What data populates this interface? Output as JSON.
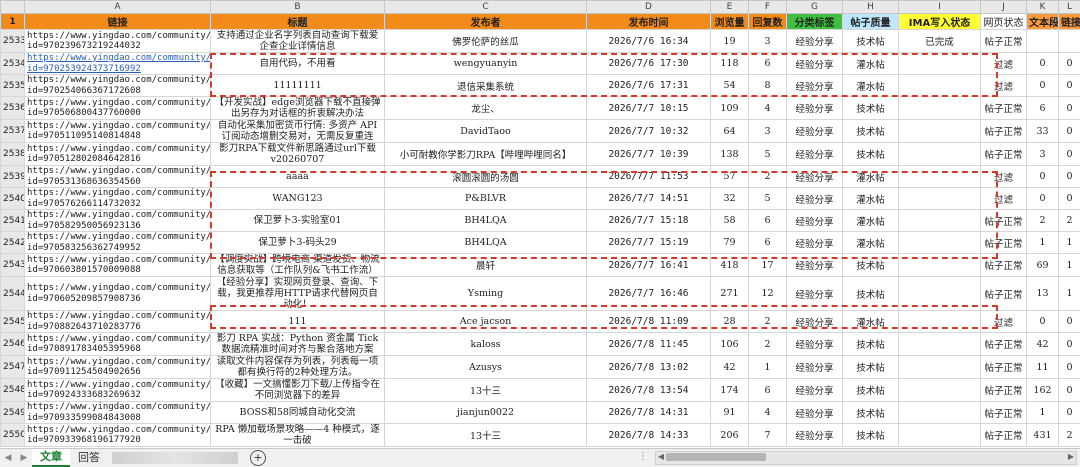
{
  "columns": [
    "A",
    "B",
    "C",
    "D",
    "E",
    "F",
    "G",
    "H",
    "I",
    "J",
    "K",
    "L"
  ],
  "header_row_num": "1",
  "headers": {
    "link": "链接",
    "title": "标题",
    "author": "发布者",
    "time": "发布时间",
    "views": "浏览量",
    "replies": "回复数",
    "label": "分类标签",
    "quality": "帖子质量",
    "ima": "IMA写入状态",
    "status": "网页状态",
    "paragraphs": "文本段落",
    "links": "链接"
  },
  "rows": [
    {
      "num": "2533",
      "url": "https://www.yingdao.com/community/detaildiscuss?id=970239673219244032",
      "title": "支持通过企业名字列表自动查询下载爱企查企业详情信息",
      "author": "佛罗伦萨的丝瓜",
      "time": "2026/7/6 16:34",
      "views": "19",
      "replies": "3",
      "label": "经验分享",
      "quality": "技术帖",
      "ima": "已完成",
      "status": "帖子正常",
      "para": "",
      "links": ""
    },
    {
      "num": "2534",
      "url": "https://www.yingdao.com/community/detaildiscuss?id=970253924373716992",
      "title": "自用代码，不用看",
      "author": "wengyuanyin",
      "time": "2026/7/6 17:30",
      "views": "118",
      "replies": "6",
      "label": "经验分享",
      "quality": "灌水帖",
      "ima": "",
      "status": "过滤",
      "para": "0",
      "links": "0"
    },
    {
      "num": "2535",
      "url": "https://www.yingdao.com/community/detaildiscuss?id=970254066367172608",
      "title": "11111111",
      "author": "退信采集系统",
      "time": "2026/7/6 17:31",
      "views": "54",
      "replies": "8",
      "label": "经验分享",
      "quality": "灌水帖",
      "ima": "",
      "status": "过滤",
      "para": "0",
      "links": "0"
    },
    {
      "num": "2536",
      "url": "https://www.yingdao.com/community/detaildiscuss?id=970506800437760000",
      "title": "【开发实战】edge浏览器下载不直接弹出另存为对话框的折衷解决办法",
      "author": "龙尘、",
      "time": "2026/7/7 10:15",
      "views": "109",
      "replies": "4",
      "label": "经验分享",
      "quality": "技术帖",
      "ima": "",
      "status": "帖子正常",
      "para": "6",
      "links": "0"
    },
    {
      "num": "2537",
      "url": "https://www.yingdao.com/community/detaildiscuss?id=970511095140814848",
      "title": "自动化采集加密货币行情: 多资产 API 订阅动态增删交易对，无需反复重连",
      "author": "DavidTaoo",
      "time": "2026/7/7 10:32",
      "views": "64",
      "replies": "3",
      "label": "经验分享",
      "quality": "技术帖",
      "ima": "",
      "status": "帖子正常",
      "para": "33",
      "links": "0"
    },
    {
      "num": "2538",
      "url": "https://www.yingdao.com/community/detaildiscuss?id=970512802084642816",
      "title": "影刀RPA下载文件新思路通过url下载v20260707",
      "author": "小可耐教你学影刀RPA【哔哩哔哩同名】",
      "time": "2026/7/7 10:39",
      "views": "138",
      "replies": "5",
      "label": "经验分享",
      "quality": "技术帖",
      "ima": "",
      "status": "帖子正常",
      "para": "3",
      "links": "0"
    },
    {
      "num": "2539",
      "url": "https://www.yingdao.com/community/detaildiscuss?id=970531368636354560",
      "title": "aaaa",
      "author": "滚圆滚圆的汤圆",
      "time": "2026/7/7 11:53",
      "views": "57",
      "replies": "2",
      "label": "经验分享",
      "quality": "灌水帖",
      "ima": "",
      "status": "过滤",
      "para": "0",
      "links": "0"
    },
    {
      "num": "2540",
      "url": "https://www.yingdao.com/community/detaildiscuss?id=970576266114732032",
      "title": "WANG123",
      "author": "P&BLVR",
      "time": "2026/7/7 14:51",
      "views": "32",
      "replies": "5",
      "label": "经验分享",
      "quality": "灌水帖",
      "ima": "",
      "status": "过滤",
      "para": "0",
      "links": "0"
    },
    {
      "num": "2541",
      "url": "https://www.yingdao.com/community/detaildiscuss?id=970582950056923136",
      "title": "保卫萝卜3-实验室01",
      "author": "BH4LQA",
      "time": "2026/7/7 15:18",
      "views": "58",
      "replies": "6",
      "label": "经验分享",
      "quality": "灌水帖",
      "ima": "",
      "status": "帖子正常",
      "para": "2",
      "links": "2"
    },
    {
      "num": "2542",
      "url": "https://www.yingdao.com/community/detaildiscuss?id=970583256362749952",
      "title": "保卫萝卜3-码头29",
      "author": "BH4LQA",
      "time": "2026/7/7 15:19",
      "views": "79",
      "replies": "6",
      "label": "经验分享",
      "quality": "灌水帖",
      "ima": "",
      "status": "帖子正常",
      "para": "1",
      "links": "1"
    },
    {
      "num": "2543",
      "url": "https://www.yingdao.com/community/detaildiscuss?id=970603801570009088",
      "title": "【调度实战】跨境电商 渠道发货、物流信息获取等（工作队列&飞书工作流）",
      "author": "晨轩",
      "time": "2026/7/7 16:41",
      "views": "418",
      "replies": "17",
      "label": "经验分享",
      "quality": "技术帖",
      "ima": "",
      "status": "帖子正常",
      "para": "69",
      "links": "1"
    },
    {
      "num": "2544",
      "url": "https://www.yingdao.com/community/detaildiscuss?id=970605209857908736",
      "title": "【经验分享】实现网页登录、查询、下载，我更推荐用HTTP请求代替网页自动化！",
      "author": "Ysming",
      "time": "2026/7/7 16:46",
      "views": "271",
      "replies": "12",
      "label": "经验分享",
      "quality": "技术帖",
      "ima": "",
      "status": "帖子正常",
      "para": "13",
      "links": "1"
    },
    {
      "num": "2545",
      "url": "https://www.yingdao.com/community/detaildiscuss?id=970882643710283776",
      "title": "111",
      "author": "Ace jacson",
      "time": "2026/7/8 11:09",
      "views": "28",
      "replies": "2",
      "label": "经验分享",
      "quality": "灌水帖",
      "ima": "",
      "status": "过滤",
      "para": "0",
      "links": "0"
    },
    {
      "num": "2546",
      "url": "https://www.yingdao.com/community/detaildiscuss?id=970891783405395968",
      "title": "影刀 RPA 实战：Python 资金属 Tick 数据流精准时间对齐与聚合落地方案",
      "author": "kaloss",
      "time": "2026/7/8 11:45",
      "views": "106",
      "replies": "2",
      "label": "经验分享",
      "quality": "技术帖",
      "ima": "",
      "status": "帖子正常",
      "para": "42",
      "links": "0"
    },
    {
      "num": "2547",
      "url": "https://www.yingdao.com/community/detaildiscuss?id=970911254504902656",
      "title": "读取文件内容保存为列表，列表每一项都有换行符的2种处理方法。",
      "author": "Azusys",
      "time": "2026/7/8 13:02",
      "views": "42",
      "replies": "1",
      "label": "经验分享",
      "quality": "技术帖",
      "ima": "",
      "status": "帖子正常",
      "para": "11",
      "links": "0"
    },
    {
      "num": "2548",
      "url": "https://www.yingdao.com/community/detaildiscuss?id=970924333683269632",
      "title": "【收藏】一文搞懂影刀下载/上传指令在不同浏览器下的差异",
      "author": "13十三",
      "time": "2026/7/8 13:54",
      "views": "174",
      "replies": "6",
      "label": "经验分享",
      "quality": "技术帖",
      "ima": "",
      "status": "帖子正常",
      "para": "162",
      "links": "0"
    },
    {
      "num": "2549",
      "url": "https://www.yingdao.com/community/detaildiscuss?id=970933599084843008",
      "title": "BOSS和58同城自动化交流",
      "author": "jianjun0022",
      "time": "2026/7/8 14:31",
      "views": "91",
      "replies": "4",
      "label": "经验分享",
      "quality": "技术帖",
      "ima": "",
      "status": "帖子正常",
      "para": "1",
      "links": "0"
    },
    {
      "num": "2550",
      "url": "https://www.yingdao.com/community/detaildiscuss?id=970933968196177920",
      "title": "RPA 懒加载场景攻略——4 种模式，逐一击破",
      "author": "13十三",
      "time": "2026/7/8 14:33",
      "views": "206",
      "replies": "7",
      "label": "经验分享",
      "quality": "技术帖",
      "ima": "",
      "status": "帖子正常",
      "para": "431",
      "links": "2"
    }
  ],
  "sheet_tabs": [
    "文章",
    "回答"
  ],
  "active_tab": "文章",
  "add_sheet_icon": "plus-circle-icon",
  "colors": {
    "header_orange": "#f38b1a",
    "header_green": "#3fbf3f",
    "header_blue": "#bfe6ff",
    "header_yellow": "#ffff33",
    "highlight_dash": "#d43a2a",
    "link_blue": "#2b5fb3"
  }
}
